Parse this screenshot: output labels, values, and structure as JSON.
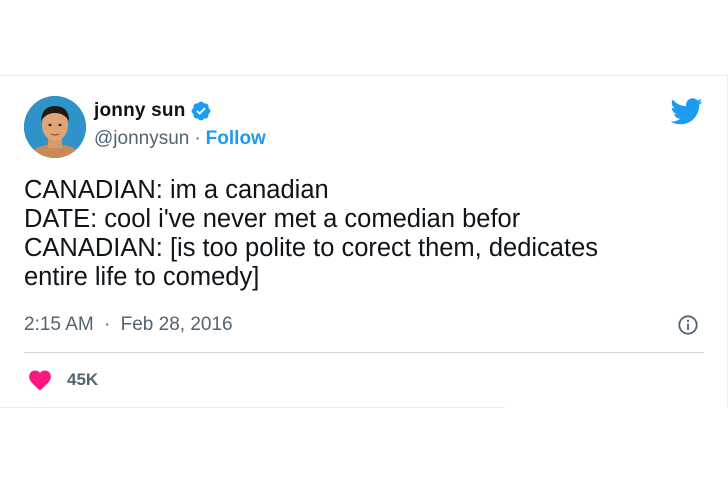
{
  "tweet": {
    "author_name": "jonny sun",
    "handle": "@jonnysun",
    "separator": "·",
    "follow_label": "Follow",
    "lines": [
      "CANADIAN: im a canadian",
      "DATE: cool i've never met a comedian befor",
      "CANADIAN: [is too polite to corect them, dedicates",
      "entire life to comedy]"
    ],
    "time": "2:15 AM",
    "date": "Feb 28, 2016",
    "likes": "45K"
  },
  "icons": {
    "verified": "verified-badge-icon",
    "logo": "twitter-bird-icon",
    "info": "info-icon",
    "like": "heart-icon"
  },
  "colors": {
    "accent": "#1d9bf0",
    "heart": "#f91880",
    "text": "#0f1419",
    "muted": "#536471"
  }
}
